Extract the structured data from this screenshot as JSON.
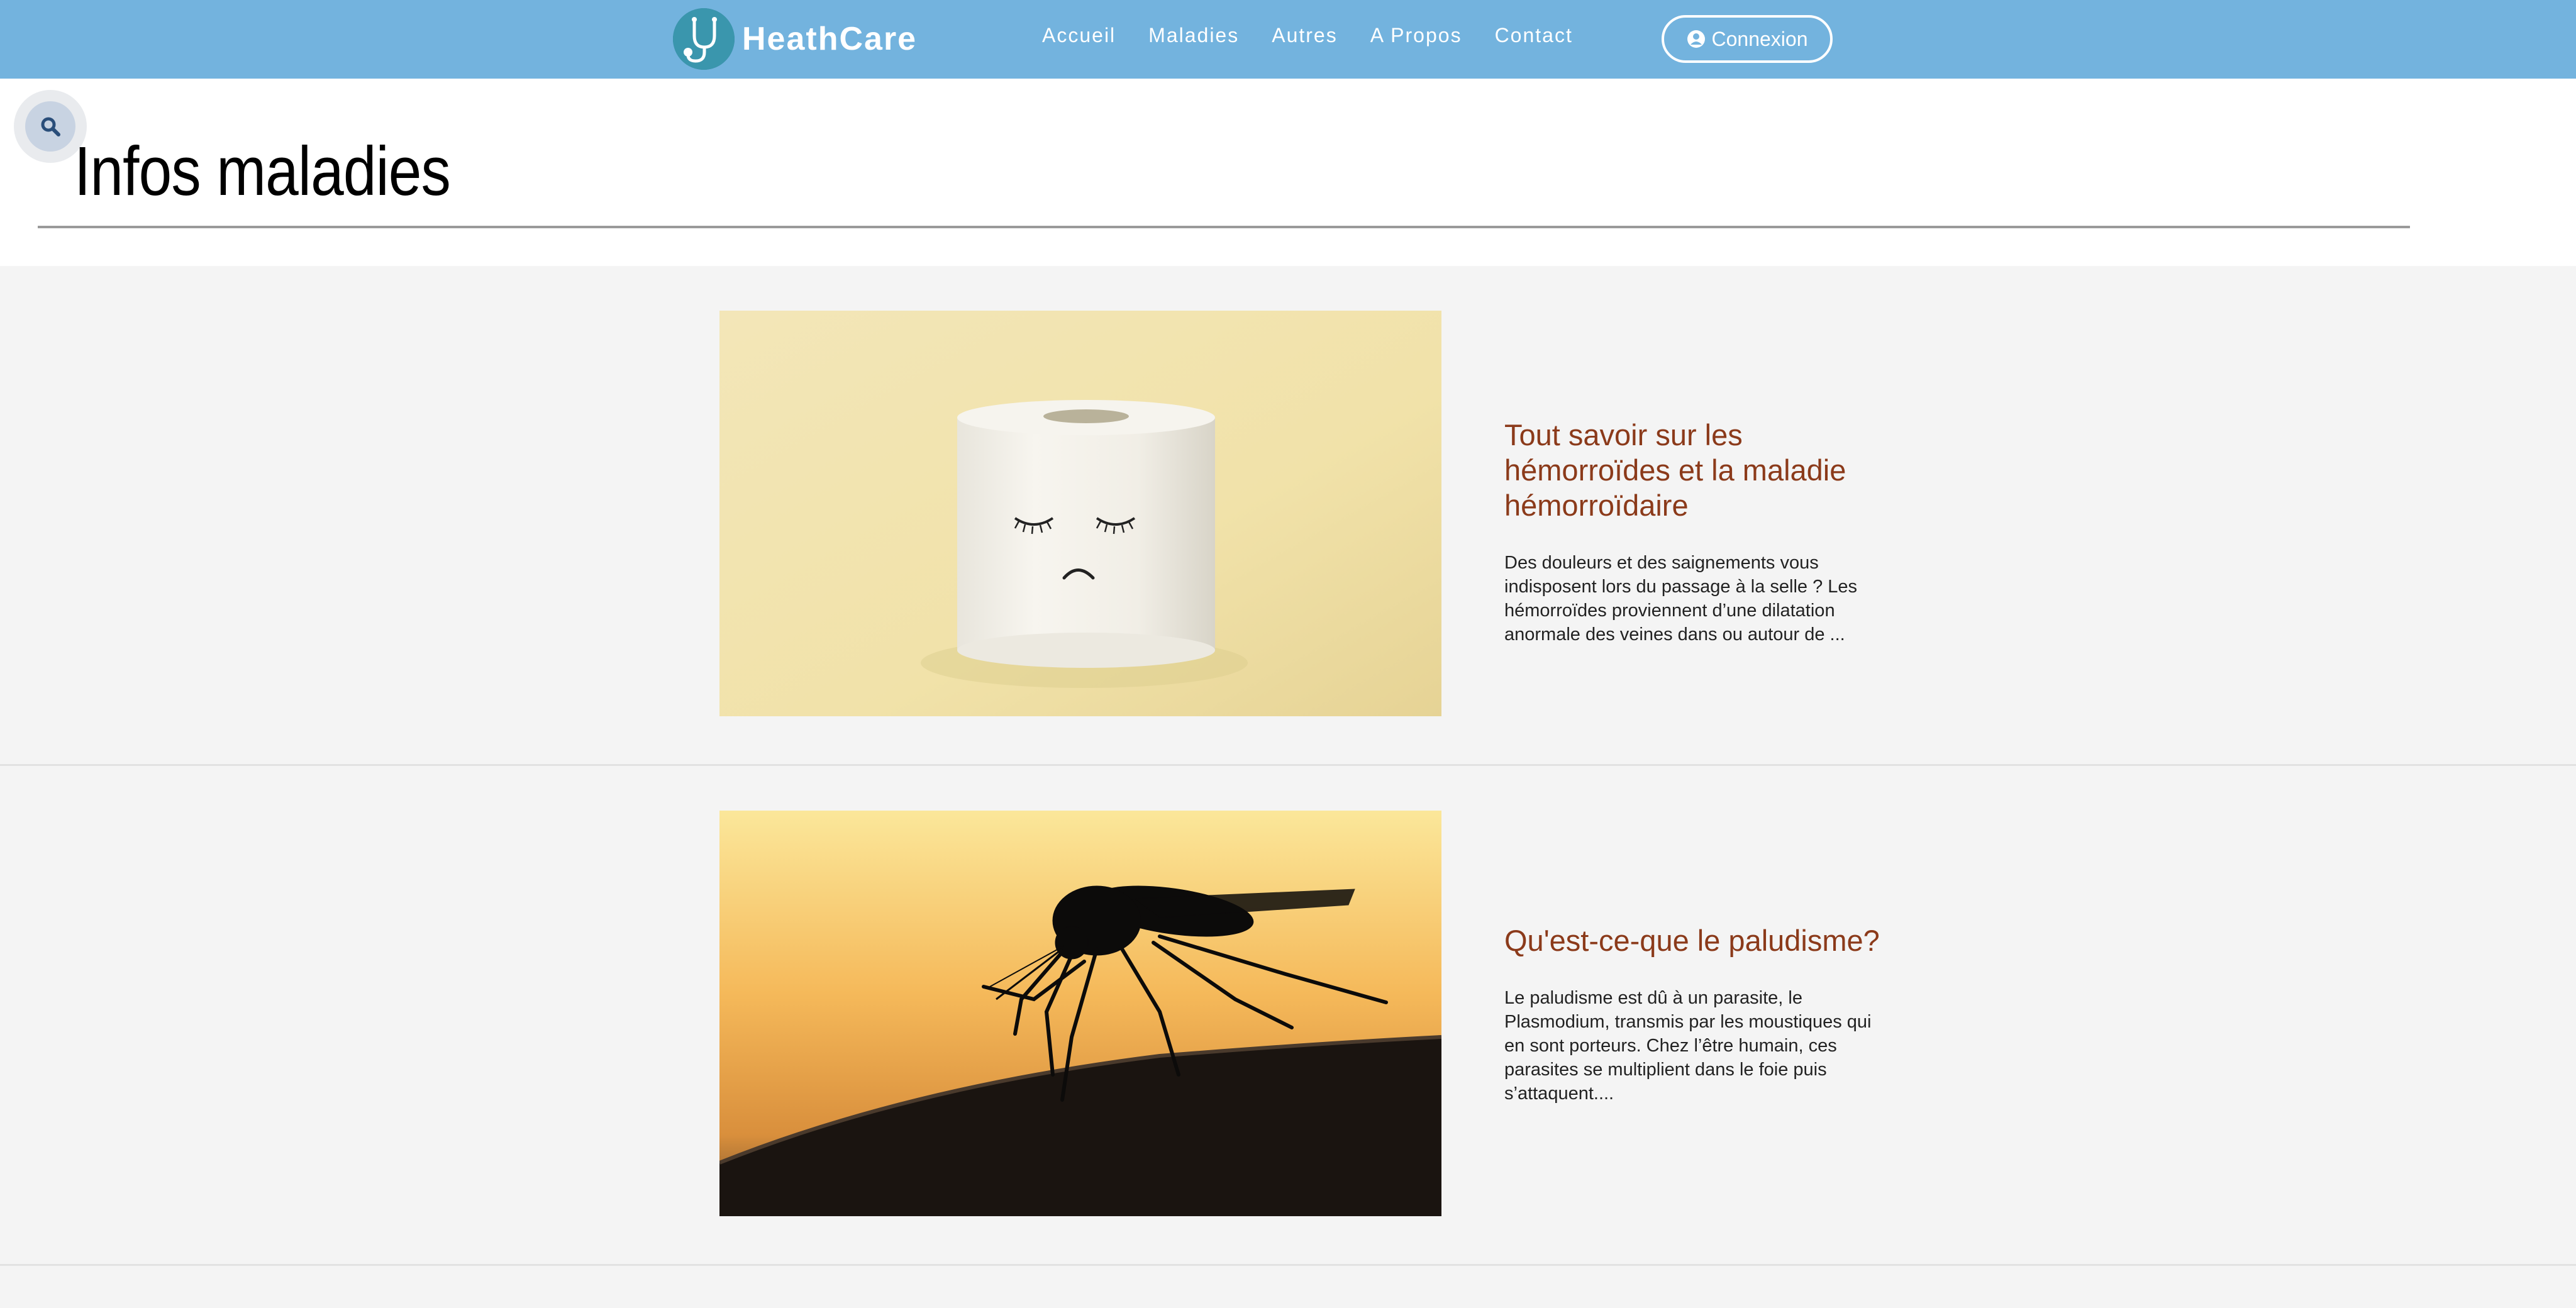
{
  "brand": {
    "name": "HeathCare"
  },
  "nav": {
    "links": [
      "Accueil",
      "Maladies",
      "Autres",
      "A Propos",
      "Contact"
    ],
    "login_label": "Connexion"
  },
  "page": {
    "title": "Infos maladies"
  },
  "articles": [
    {
      "title": "Tout savoir sur les hémorroïdes et la maladie hémorroïdaire",
      "excerpt": "Des douleurs et des saignements vous indisposent lors du passage à la selle ? Les hémorroïdes proviennent d’une dilatation anormale des veines dans ou autour de ...",
      "image": "toilet-paper-sad-face-photo"
    },
    {
      "title": "Qu'est-ce-que le paludisme?",
      "excerpt": "Le paludisme est dû à un parasite, le Plasmodium, transmis par les moustiques qui en sont porteurs. Chez l’être humain, ces parasites se multiplient dans le foie puis s’attaquent....",
      "image": "mosquito-silhouette-photo"
    }
  ],
  "colors": {
    "navbar": "#73b3de",
    "article_title": "#8b3a1a",
    "page_bg": "#f4f4f4"
  }
}
